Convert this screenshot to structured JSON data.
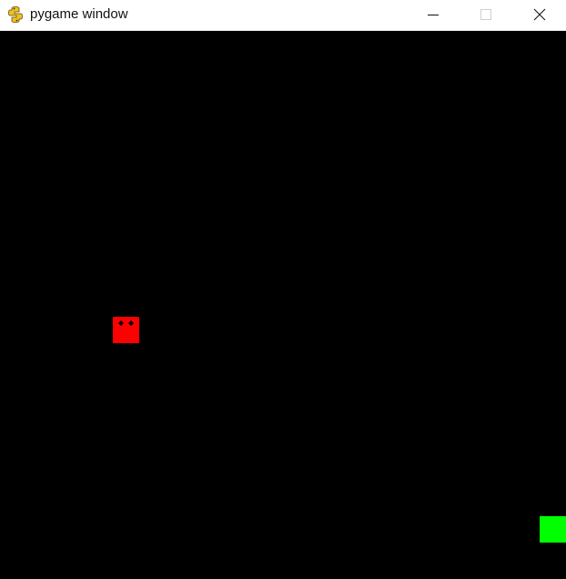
{
  "window": {
    "title": "pygame window",
    "icon": "pygame-snake-icon",
    "controls": {
      "minimize": "minimize-icon",
      "maximize": "maximize-icon",
      "close": "close-icon"
    }
  },
  "game": {
    "background_color": "#000000",
    "enemy": {
      "color": "#ff0000",
      "eye_color": "#000000"
    },
    "player": {
      "color": "#00ff00"
    }
  }
}
